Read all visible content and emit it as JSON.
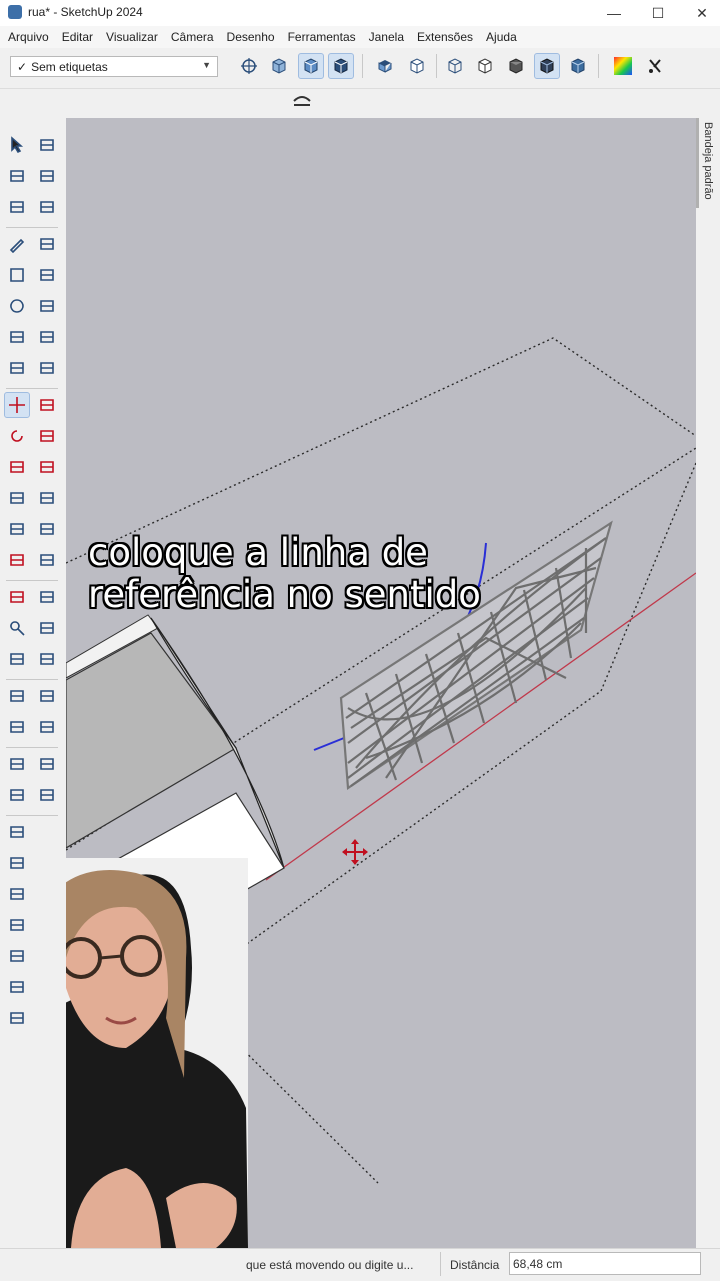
{
  "window": {
    "title": "rua* - SketchUp 2024",
    "controls": [
      "minimize-icon",
      "maximize-icon",
      "close-icon"
    ]
  },
  "menu": [
    "Arquivo",
    "Editar",
    "Visualizar",
    "Câmera",
    "Desenho",
    "Ferramentas",
    "Janela",
    "Extensões",
    "Ajuda"
  ],
  "toolbar": {
    "tag_select": "Sem etiquetas",
    "buttons": [
      "orbit-icon",
      "zoom-extents-icon",
      "iso-view-icon",
      "front-view-icon",
      "xray-icon",
      "back-edges-icon",
      "wireframe-icon",
      "hidden-line-icon",
      "shaded-icon",
      "shaded-textures-icon",
      "monochrome-icon",
      "styles-icon",
      "section-plane-icon"
    ]
  },
  "left_toolbar": {
    "active_tool": "move-tool"
  },
  "viewport": {
    "caption_lines": [
      "coloque a linha de",
      "referência no sentido"
    ],
    "axis_colors": {
      "red": "#c0394b",
      "blue": "#2a2fd6",
      "green": "#2f9e44"
    },
    "background": "#bcbcc3"
  },
  "right_panel": {
    "label": "Bandeja padrão"
  },
  "status": {
    "text": "que está movendo ou digite u...",
    "distance_label": "Distância",
    "distance_value": "68,48 cm"
  }
}
